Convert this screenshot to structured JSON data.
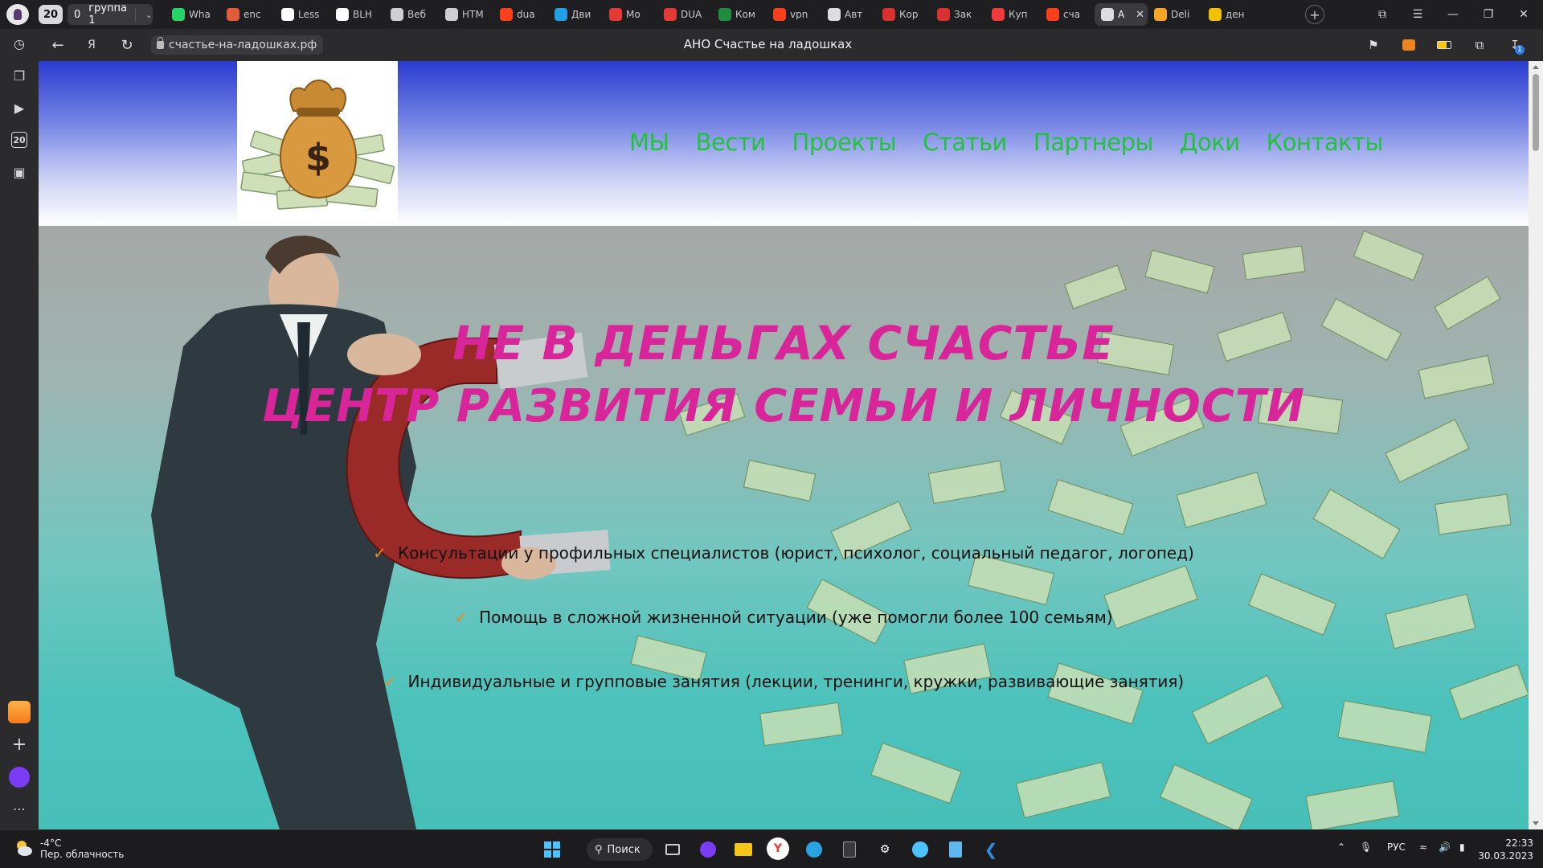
{
  "browser": {
    "tab_count": "20",
    "group_counter": "0",
    "group_label": "группа 1",
    "tabs": [
      {
        "label": "Wha",
        "icon": "whatsapp-icon",
        "color": "#25d366"
      },
      {
        "label": "enc",
        "icon": "globe-icon",
        "color": "#e25b3b"
      },
      {
        "label": "Less",
        "icon": "github-icon",
        "color": "#ffffff"
      },
      {
        "label": "BLH",
        "icon": "github-icon",
        "color": "#ffffff"
      },
      {
        "label": "Веб",
        "icon": "openai-icon",
        "color": "#cfcfcf"
      },
      {
        "label": "HTM",
        "icon": "openai-icon",
        "color": "#cfcfcf"
      },
      {
        "label": "dua",
        "icon": "yandex-icon",
        "color": "#fc3f1d"
      },
      {
        "label": "Дви",
        "icon": "plane-icon",
        "color": "#21a0e8"
      },
      {
        "label": "Мо",
        "icon": "star-icon",
        "color": "#e53935"
      },
      {
        "label": "DUA",
        "icon": "star-icon",
        "color": "#e53935"
      },
      {
        "label": "Ком",
        "icon": "excel-icon",
        "color": "#1e8e3e"
      },
      {
        "label": "vpn",
        "icon": "yandex-icon",
        "color": "#fc3f1d"
      },
      {
        "label": "Авт",
        "icon": "document-icon",
        "color": "#dddddd"
      },
      {
        "label": "Кор",
        "icon": "globe-icon",
        "color": "#d93030"
      },
      {
        "label": "Зак",
        "icon": "globe-icon",
        "color": "#d93030"
      },
      {
        "label": "Куп",
        "icon": "globe-icon",
        "color": "#ef3b3b"
      },
      {
        "label": "сча",
        "icon": "yandex-icon",
        "color": "#fc3f1d"
      },
      {
        "label": "А",
        "icon": "document-icon",
        "color": "#dddddd",
        "active": true
      },
      {
        "label": "Deli",
        "icon": "globe-icon",
        "color": "#f5a623"
      },
      {
        "label": "ден",
        "icon": "image-icon",
        "color": "#f2c200"
      }
    ],
    "url": "счастье-на-ладошках.рф",
    "page_title": "АНО Счастье на ладошках",
    "download_badge": "1"
  },
  "sidebar": {
    "items": [
      {
        "name": "history-icon"
      },
      {
        "name": "collections-icon"
      },
      {
        "name": "video-icon"
      },
      {
        "name": "tab-count-icon",
        "label": "20"
      },
      {
        "name": "screenshot-icon"
      }
    ]
  },
  "site": {
    "nav": [
      "МЫ",
      "Вести",
      "Проекты",
      "Статьи",
      "Партнеры",
      "Доки",
      "Контакты"
    ],
    "hero_title_1": "НЕ В ДЕНЬГАХ СЧАСТЬЕ",
    "hero_title_2": "ЦЕНТР РАЗВИТИЯ СЕМЬИ И ЛИЧНОСТИ",
    "features": [
      "Консультации у профильных специалистов (юрист, психолог, социальный педагог, логопед)",
      "Помощь в сложной жизненной ситуации (уже помогли более 100 семьям)",
      "Индивидуальные и групповые занятия (лекции, тренинги, кружки, развивающие занятия)"
    ],
    "colors": {
      "nav": "#22c33c",
      "title": "#d8259a",
      "check": "#f08a1e"
    }
  },
  "taskbar": {
    "weather_temp": "-4°C",
    "weather_desc": "Пер. облачность",
    "search_label": "Поиск",
    "language": "РУС",
    "time": "22:33",
    "date": "30.03.2023"
  }
}
